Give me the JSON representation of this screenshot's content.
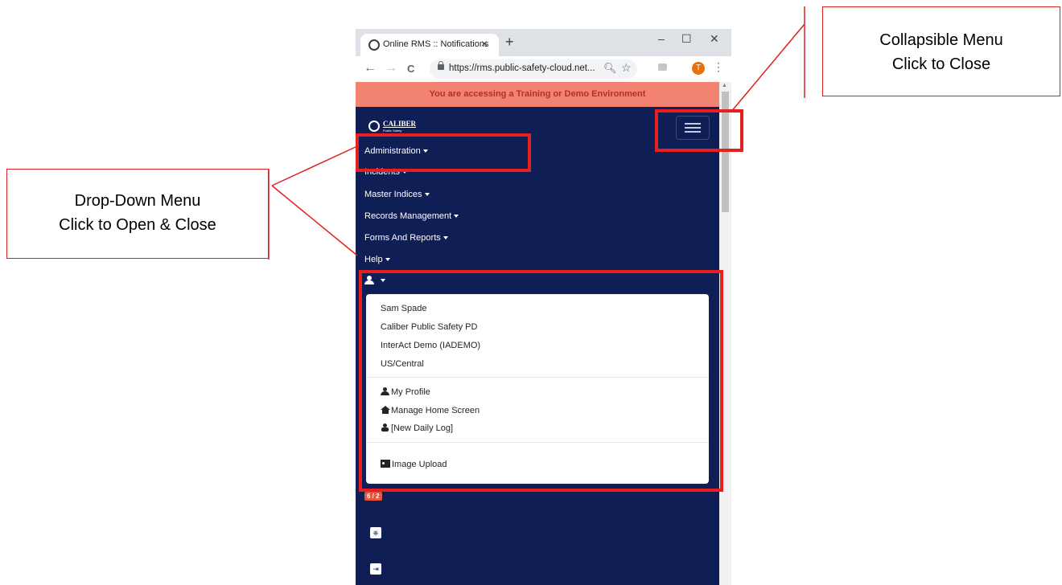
{
  "browser": {
    "tab_title": "Online RMS :: Notifications",
    "tab_close": "×",
    "new_tab": "+",
    "url": "https://rms.public-safety-cloud.net...",
    "minimize": "–",
    "maximize": "☐",
    "close": "✕",
    "profile_initial": "T",
    "back": "←",
    "forward": "→",
    "reload": "C",
    "kebab": "⋮"
  },
  "page": {
    "banner": "You are accessing a Training or Demo Environment",
    "logo": {
      "name": "CALIBER",
      "sub": "Public Safety"
    },
    "nav": [
      {
        "label": "Administration"
      },
      {
        "label": "Incidents"
      },
      {
        "label": "Master Indices"
      },
      {
        "label": "Records Management"
      },
      {
        "label": "Forms And Reports"
      },
      {
        "label": "Help"
      }
    ],
    "user_dropdown": {
      "info": [
        "Sam Spade",
        "Caliber Public Safety PD",
        "InterAct Demo (IADEMO)",
        "US/Central"
      ],
      "actions": [
        {
          "label": "My Profile",
          "icon": "user-icon"
        },
        {
          "label": "Manage Home Screen",
          "icon": "home-icon"
        },
        {
          "label": "[New Daily Log]",
          "icon": "badge-icon"
        }
      ],
      "upload": {
        "label": "Image Upload",
        "icon": "image-icon"
      }
    },
    "counter_badge": "6 / 2",
    "settings_glyph": "⎈",
    "logout_glyph": "⇥"
  },
  "annotations": {
    "collapsible_menu": {
      "line1": "Collapsible Menu",
      "line2": "Click to Close"
    },
    "dropdown_menu": {
      "line1": "Drop-Down Menu",
      "line2": "Click to Open & Close"
    },
    "highlight_color": "#e81f1f"
  },
  "colors": {
    "navbar_bg": "#0f1f56",
    "banner_bg": "#f28373",
    "banner_text": "#b5311e",
    "counter_badge": "#e8553e"
  }
}
